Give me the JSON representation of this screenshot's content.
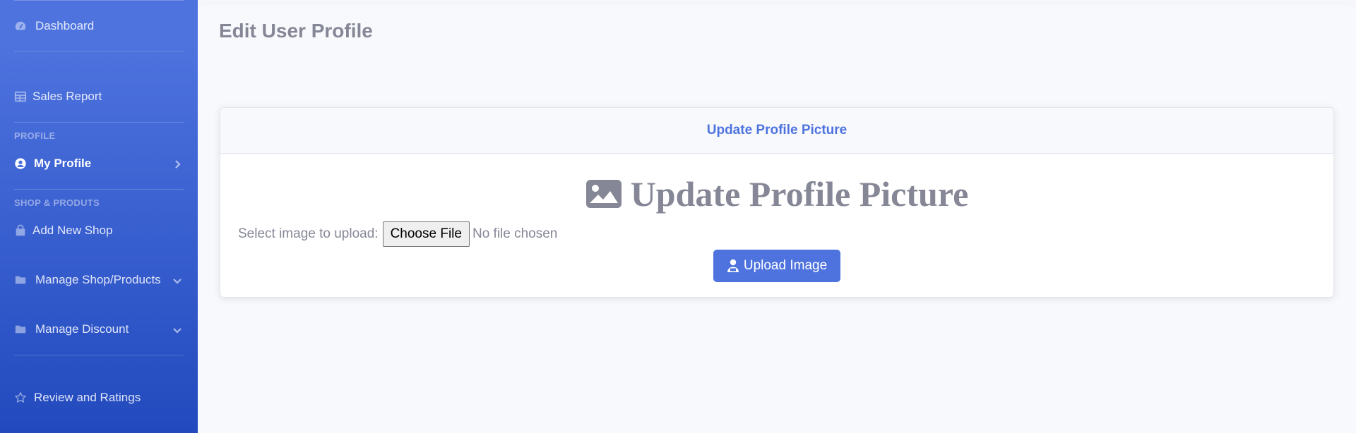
{
  "sidebar": {
    "items": [
      {
        "label": "Dashboard",
        "icon": "tachometer-icon"
      },
      {
        "label": "Sales Report",
        "icon": "table-icon"
      },
      {
        "label": "My Profile",
        "icon": "user-circle-icon"
      },
      {
        "label": "Add New Shop",
        "icon": "shopping-bag-icon"
      },
      {
        "label": "Manage Shop/Products",
        "icon": "folder-icon"
      },
      {
        "label": "Manage Discount",
        "icon": "folder-icon"
      },
      {
        "label": "Review and Ratings",
        "icon": "star-icon"
      }
    ],
    "headings": {
      "profile": "PROFILE",
      "shop": "SHOP & PRODUTS"
    }
  },
  "page": {
    "title": "Edit User Profile"
  },
  "card": {
    "header": "Update Profile Picture",
    "big_title": "Update Profile Picture",
    "upload_label": "Select image to upload:",
    "choose_file": "Choose File",
    "no_file": "No file chosen",
    "upload_button": "Upload Image"
  },
  "colors": {
    "primary": "#4e73df",
    "sidebar_end": "#224abe",
    "text_muted": "#858796",
    "background": "#f8f9fc"
  }
}
